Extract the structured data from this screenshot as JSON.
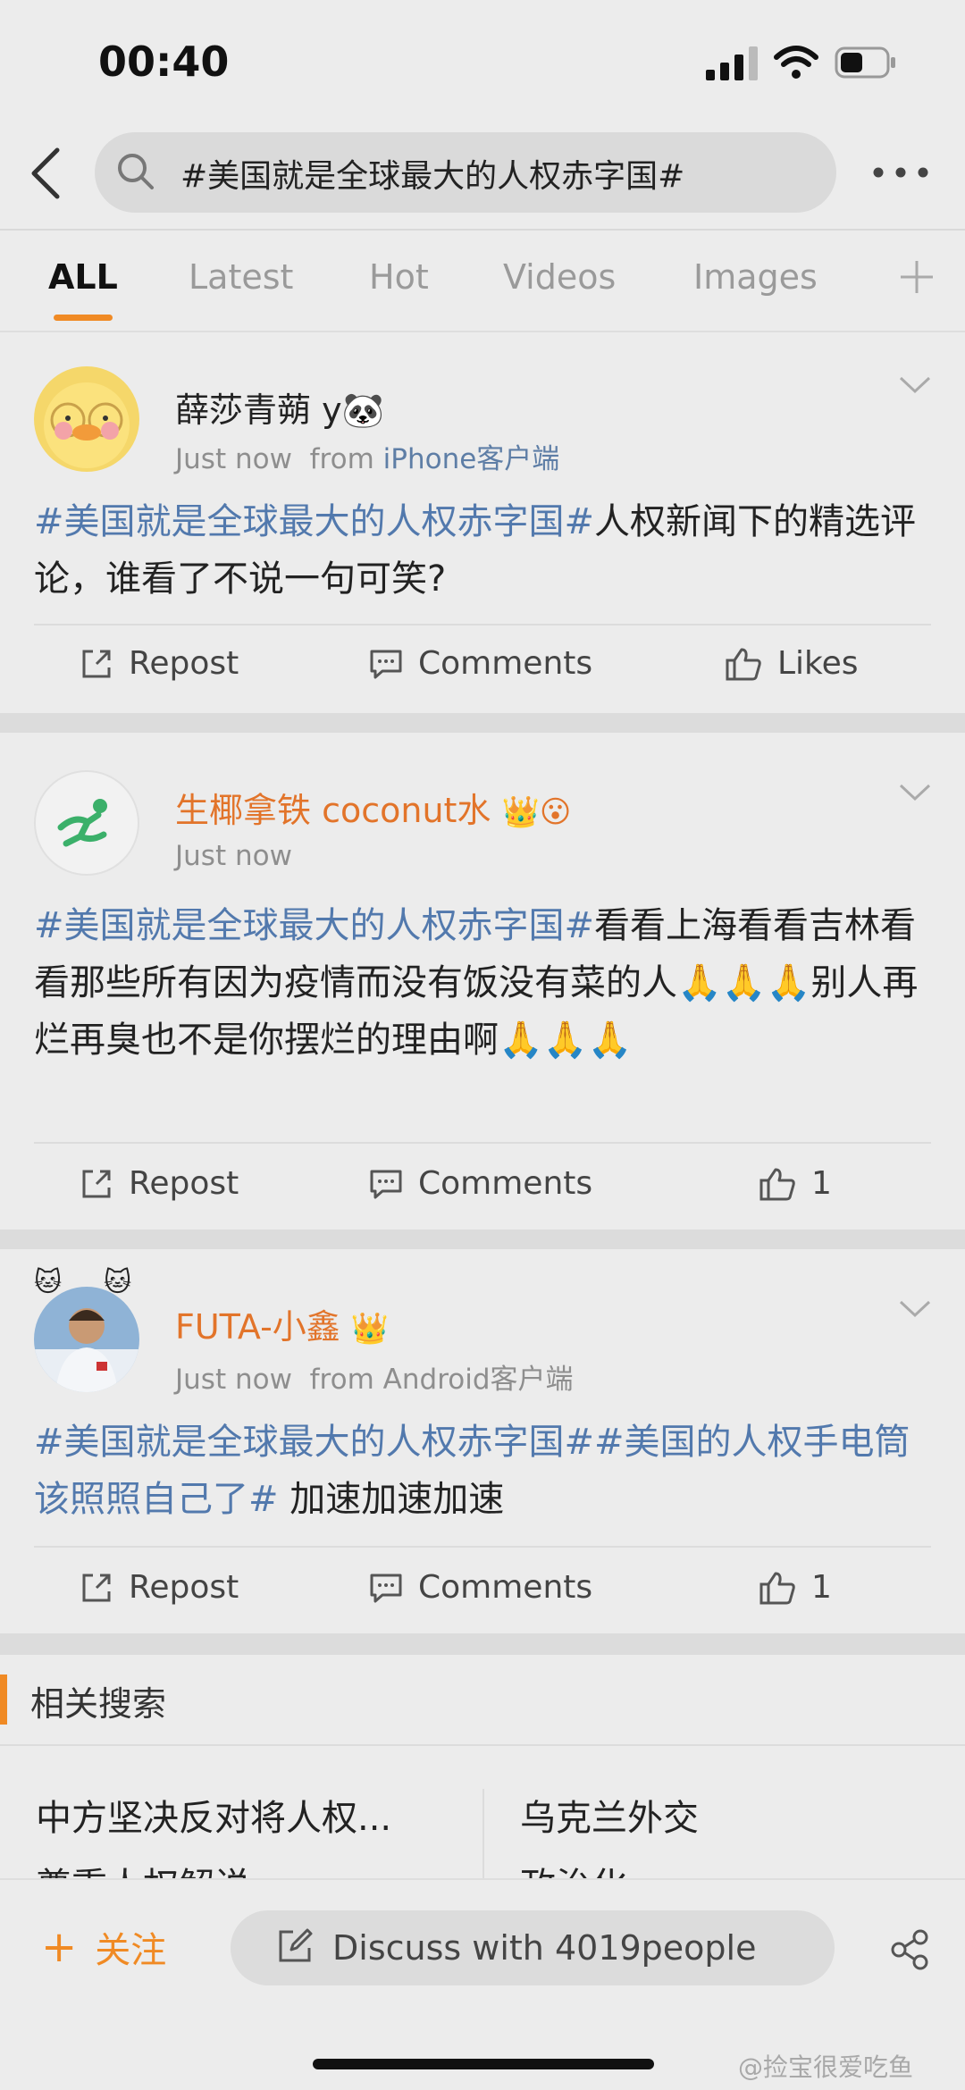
{
  "status_bar": {
    "time": "00:40"
  },
  "search": {
    "query": "#美国就是全球最大的人权赤字国#"
  },
  "tabs": [
    {
      "label": "ALL",
      "active": true
    },
    {
      "label": "Latest"
    },
    {
      "label": "Hot"
    },
    {
      "label": "Videos"
    },
    {
      "label": "Images"
    }
  ],
  "posts": [
    {
      "username": "薛莎青蒴 y🐼",
      "time": "Just now",
      "from_prefix": "from",
      "source": "iPhone客户端",
      "tag": "#美国就是全球最大的人权赤字国#",
      "text": "人权新闻下的精选评论，谁看了不说一句可笑?",
      "repost": "Repost",
      "comments": "Comments",
      "likes": "Likes"
    },
    {
      "username": "生椰拿铁 coconut水",
      "time": "Just now",
      "tag": "#美国就是全球最大的人权赤字国#",
      "text": "看看上海看看吉林看看那些所有因为疫情而没有饭没有菜的人🙏🙏🙏别人再烂再臭也不是你摆烂的理由啊🙏🙏🙏",
      "repost": "Repost",
      "comments": "Comments",
      "likes": "1"
    },
    {
      "username": "FUTA-小鑫",
      "time": "Just now",
      "from_prefix": "from",
      "source": "Android客户端",
      "tag": "#美国就是全球最大的人权赤字国#",
      "tag2": "#美国的人权手电筒该照照自己了#",
      "text": " 加速加速加速",
      "repost": "Repost",
      "comments": "Comments",
      "likes": "1"
    }
  ],
  "related": {
    "title": "相关搜索",
    "items": [
      "中方坚决反对将人权...",
      "乌克兰外交",
      "尊重人权解说",
      "政治化"
    ]
  },
  "bottom": {
    "follow": "关注",
    "follow_plus": "+",
    "discuss": "Discuss with 4019people"
  },
  "watermark": "@捡宝很爱吃鱼",
  "colors": {
    "accent": "#f08a24",
    "hashtag": "#5279ad",
    "vip_name": "#e2742a"
  }
}
